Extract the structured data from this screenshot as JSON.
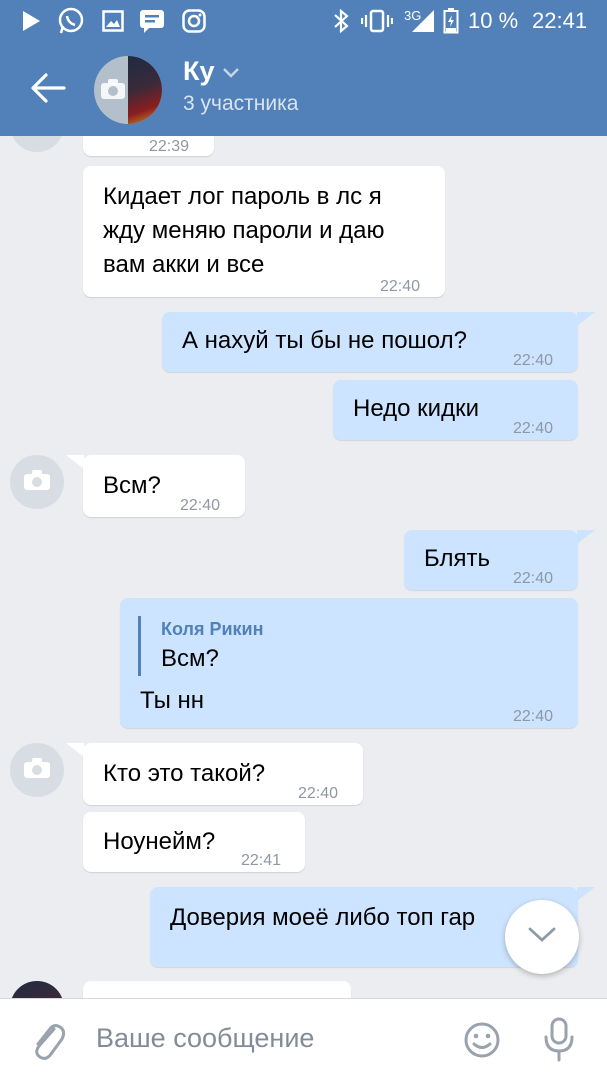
{
  "status_bar": {
    "network": "3G",
    "battery": "10 %",
    "clock": "22:41",
    "icons": [
      "play-icon",
      "whatsapp-icon",
      "gallery-icon",
      "sms-icon",
      "instagram-icon",
      "bluetooth-icon",
      "vibrate-icon",
      "signal-icon",
      "battery-icon"
    ]
  },
  "header": {
    "title": "Ку",
    "subtitle": "3 участника"
  },
  "messages": [
    {
      "dir": "in",
      "time": "22:39"
    },
    {
      "dir": "in",
      "lines": [
        "Кидает лог пароль в лс я",
        "жду меняю пароли и даю",
        "вам акки и все"
      ],
      "time": "22:40"
    },
    {
      "dir": "out",
      "text": "А нахуй ты бы не пошол?",
      "time": "22:40"
    },
    {
      "dir": "out",
      "text": "Недо кидки",
      "time": "22:40"
    },
    {
      "dir": "in",
      "text": "Всм?",
      "time": "22:40"
    },
    {
      "dir": "out",
      "text": "Блять",
      "time": "22:40"
    },
    {
      "dir": "out",
      "reply": {
        "author": "Коля Рикин",
        "text": "Всм?"
      },
      "text": "Ты нн",
      "time": "22:40"
    },
    {
      "dir": "in",
      "text": "Кто это такой?",
      "time": "22:40"
    },
    {
      "dir": "in",
      "text": "Ноунейм?",
      "time": "22:41"
    },
    {
      "dir": "out",
      "text": "Доверия моеё либо топ гар"
    }
  ],
  "composer": {
    "placeholder": "Ваше сообщение"
  },
  "colors": {
    "header": "#5181b8",
    "incoming": "#ffffff",
    "outgoing": "#cce4ff",
    "background": "#ebedf0",
    "time": "#8f98a3"
  }
}
